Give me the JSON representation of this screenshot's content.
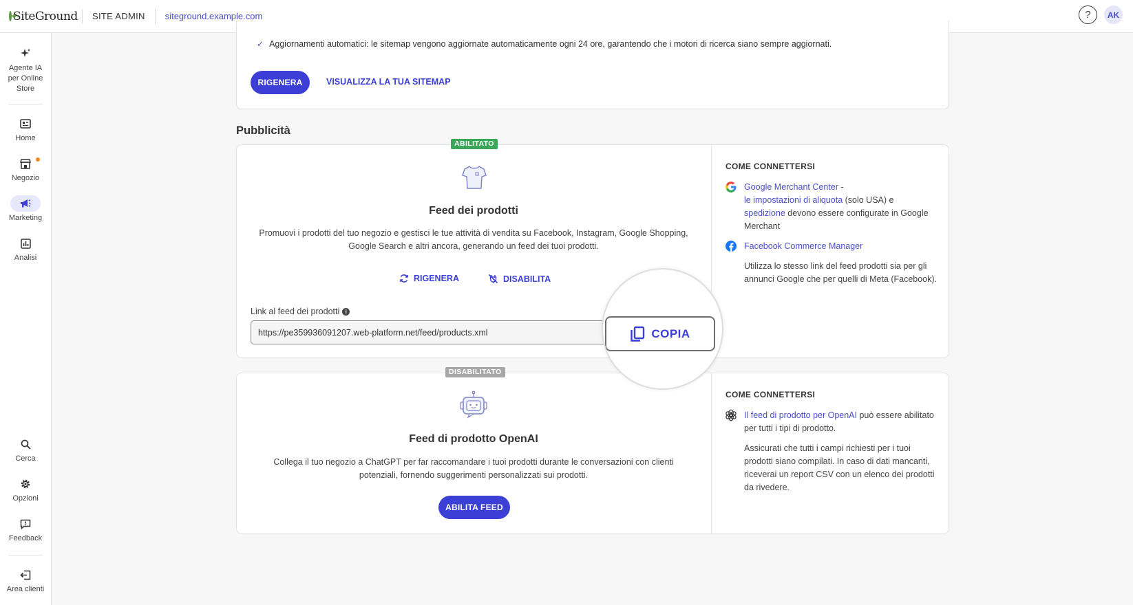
{
  "topbar": {
    "logo_text": "SiteGround",
    "section": "SITE ADMIN",
    "domain": "siteground.example.com",
    "help_label": "?",
    "avatar_initials": "AK"
  },
  "sidebar": {
    "items": [
      {
        "label": "Agente IA per Online Store",
        "icon": "sparkle-icon"
      },
      {
        "label": "Home",
        "icon": "dashboard-icon"
      },
      {
        "label": "Negozio",
        "icon": "store-icon",
        "notification_dot": true
      },
      {
        "label": "Marketing",
        "icon": "megaphone-icon",
        "active": true
      },
      {
        "label": "Analisi",
        "icon": "chart-icon"
      },
      {
        "label": "Cerca",
        "icon": "search-icon"
      },
      {
        "label": "Opzioni",
        "icon": "gear-icon"
      },
      {
        "label": "Feedback",
        "icon": "feedback-icon"
      },
      {
        "label": "Area clienti",
        "icon": "exit-icon"
      }
    ]
  },
  "sitemap": {
    "check_text": "Aggiornamenti automatici: le sitemap vengono aggiornate automaticamente ogni 24 ore, garantendo che i motori di ricerca siano sempre aggiornati.",
    "regenerate_label": "RIGENERA",
    "view_label": "VISUALIZZA LA TUA SITEMAP"
  },
  "advertising": {
    "section_title": "Pubblicità",
    "product_feed": {
      "badge": "ABILITATO",
      "icon": "tshirt-icon",
      "title": "Feed dei prodotti",
      "description": "Promuovi i prodotti del tuo negozio e gestisci le tue attività di vendita su Facebook, Instagram, Google Shopping, Google Search e altri ancora, generando un feed dei tuoi prodotti.",
      "regenerate_label": "RIGENERA",
      "disable_label": "DISABILITA",
      "link_label": "Link al feed dei prodotti",
      "link_value": "https://pe359936091207.web-platform.net/feed/products.xml",
      "copy_label": "COPIA",
      "how_to": {
        "heading": "COME CONNETTERSI",
        "google_link": "Google Merchant Center",
        "google_sep": " - ",
        "tax_link": "le impostazioni di aliquota",
        "tax_text": " (solo USA) e ",
        "shipping_link": "spedizione",
        "shipping_text": " devono essere configurate in Google Merchant",
        "facebook_link": "Facebook Commerce Manager",
        "note": "Utilizza lo stesso link del feed prodotti sia per gli annunci Google che per quelli di Meta (Facebook)."
      }
    },
    "openai_feed": {
      "badge": "DISABILITATO",
      "icon": "robot-icon",
      "title": "Feed di prodotto OpenAI",
      "description": "Collega il tuo negozio a ChatGPT per far raccomandare i tuoi prodotti durante le conversazioni con clienti potenziali, fornendo suggerimenti personalizzati sui prodotti.",
      "enable_label": "ABILITA FEED",
      "how_to": {
        "heading": "COME CONNETTERSI",
        "openai_link": "Il feed di prodotto per OpenAI",
        "openai_text": " può essere abilitato per tutti i tipi di prodotto.",
        "note": "Assicurati che tutti i campi richiesti per i tuoi prodotti siano compilati. In caso di dati mancanti, riceverai un report CSV con un elenco dei prodotti da rivedere."
      }
    }
  },
  "colors": {
    "accent": "#3b3fd6",
    "enabled_badge": "#3aa658",
    "disabled_badge": "#a7a7a7",
    "notification": "#f08a24"
  }
}
